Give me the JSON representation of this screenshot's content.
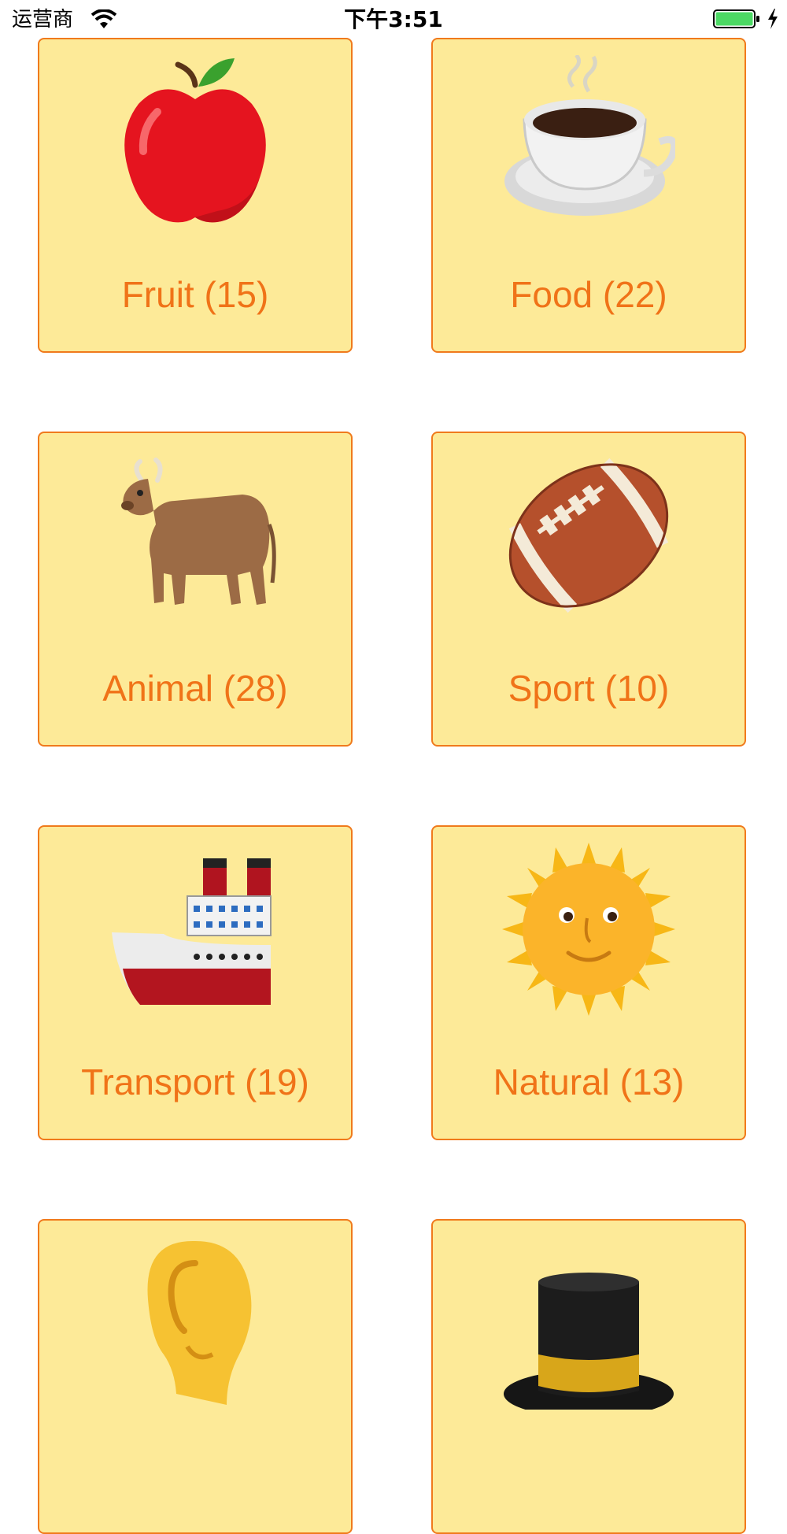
{
  "status_bar": {
    "carrier": "运营商",
    "time": "下午3:51",
    "battery_color": "#4cd964"
  },
  "theme": {
    "tile_background": "#fdea98",
    "tile_border": "#f07a1c",
    "label_color": "#f07318"
  },
  "categories": [
    {
      "icon": "apple-icon",
      "label": "Fruit (15)"
    },
    {
      "icon": "coffee-icon",
      "label": "Food (22)"
    },
    {
      "icon": "ox-icon",
      "label": "Animal (28)"
    },
    {
      "icon": "football-icon",
      "label": "Sport (10)"
    },
    {
      "icon": "ship-icon",
      "label": "Transport (19)"
    },
    {
      "icon": "sun-face-icon",
      "label": "Natural (13)"
    },
    {
      "icon": "ear-icon",
      "label": ""
    },
    {
      "icon": "top-hat-icon",
      "label": ""
    }
  ]
}
